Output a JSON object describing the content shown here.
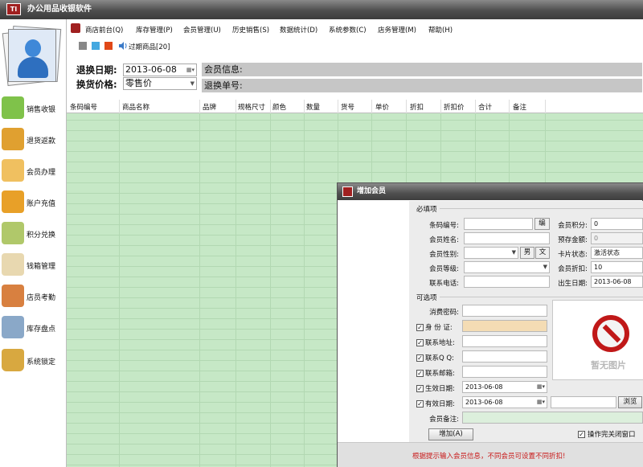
{
  "app": {
    "title": "办公用品收银软件",
    "logo_text": "TI"
  },
  "menu": {
    "items": [
      "商店前台(Q)",
      "库存管理(P)",
      "会员管理(U)",
      "历史销售(S)",
      "数据统计(D)",
      "系统参数(C)",
      "店务管理(M)",
      "帮助(H)"
    ],
    "expired_goods": "过期商品[20]"
  },
  "colors": {
    "grid_green": "#c6e8c6",
    "title_gray": "#4e4e4e",
    "warning_red": "#c81818",
    "square_gray": "#888888",
    "square_blue": "#44a8e0",
    "square_orange": "#e04818"
  },
  "sidebar": {
    "items": [
      {
        "label": "销售收银",
        "icon": "sale-tag-icon"
      },
      {
        "label": "退货返款",
        "icon": "return-box-icon"
      },
      {
        "label": "会员办理",
        "icon": "member-card-icon"
      },
      {
        "label": "账户充值",
        "icon": "recharge-card-icon"
      },
      {
        "label": "积分兑换",
        "icon": "points-exchange-icon"
      },
      {
        "label": "钱箱管理",
        "icon": "cash-box-icon"
      },
      {
        "label": "店员考勤",
        "icon": "staff-attendance-icon"
      },
      {
        "label": "库存盘点",
        "icon": "inventory-house-icon"
      },
      {
        "label": "系统锁定",
        "icon": "lock-icon"
      }
    ]
  },
  "filters": {
    "return_date_label": "退换日期:",
    "return_date_value": "2013-06-08",
    "exchange_price_label": "换货价格:",
    "exchange_price_value": "零售价",
    "member_info_label": "会员信息:",
    "return_no_label": "退换单号:"
  },
  "table": {
    "columns": [
      "条码编号",
      "商品名称",
      "品牌",
      "规格尺寸",
      "颜色",
      "数量",
      "货号",
      "单价",
      "折扣",
      "折扣价",
      "合计",
      "备注"
    ]
  },
  "dialog": {
    "title": "增加会员",
    "required_section": "必填项",
    "optional_section": "可选项",
    "fields": {
      "barcode_label": "条码编号:",
      "edit_button": "编",
      "points_label": "会员积分:",
      "points_value": "0",
      "name_label": "会员姓名:",
      "prepaid_label": "预存金额:",
      "prepaid_value": "0",
      "gender_label": "会员性别:",
      "male_button": "男",
      "female_button": "文",
      "card_status_label": "卡片状态:",
      "card_status_value": "激活状态",
      "level_label": "会员等级:",
      "discount_label": "会员折扣:",
      "discount_value": "10",
      "phone_label": "联系电话:",
      "birthday_label": "出生日期:",
      "birthday_value": "2013-06-08",
      "password_label": "消费密码:",
      "id_label": "身 份 证:",
      "address_label": "联系地址:",
      "qq_label": "联系Q Q:",
      "email_label": "联系邮箱:",
      "effective_label": "生效日期:",
      "effective_value": "2013-06-08",
      "expiry_label": "有效日期:",
      "expiry_value": "2013-06-08",
      "note_label": "会员备注:"
    },
    "browse_button": "浏览",
    "add_button": "增加(A)",
    "close_after_label": "操作完关闭窗口",
    "no_image_text": "暂无图片",
    "footer_message": "根据提示输入会员信息，不同会员可设置不同折扣!"
  }
}
